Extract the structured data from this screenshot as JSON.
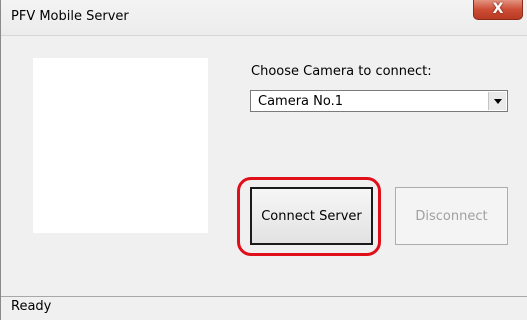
{
  "window": {
    "title": "PFV Mobile Server",
    "close_glyph": "X"
  },
  "camera": {
    "label": "Choose Camera to connect:",
    "selected": "Camera No.1"
  },
  "buttons": {
    "connect": "Connect Server",
    "disconnect": "Disconnect"
  },
  "status": {
    "text": "Ready"
  },
  "colors": {
    "highlight": "#e0101b",
    "close_button": "#cd4d35"
  }
}
